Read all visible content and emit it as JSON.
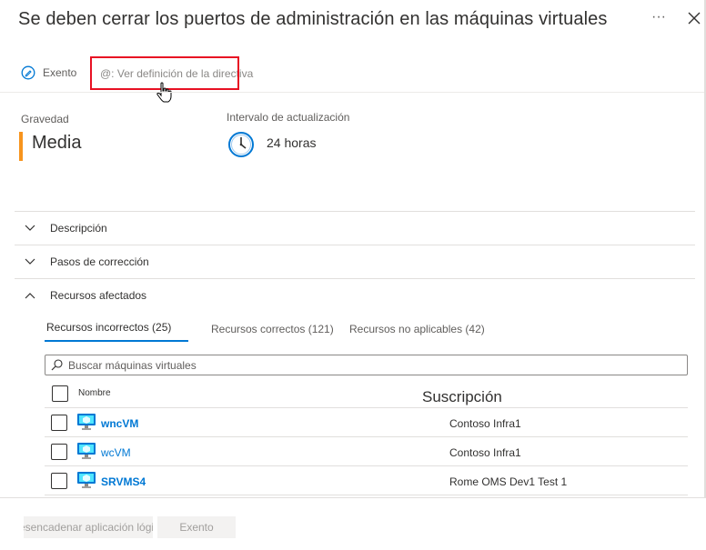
{
  "header": {
    "title": "Se deben cerrar los puertos de administración en las máquinas virtuales",
    "more_label": "···"
  },
  "toolbar": {
    "exempt_label": "Exento",
    "policy_link_label": "@: Ver definición de la directiva"
  },
  "summary": {
    "severity_label": "Gravedad",
    "severity_value": "Media",
    "severity_color": "#f7941d",
    "freshness_label": "Intervalo de actualización",
    "freshness_value": "24 horas"
  },
  "sections": {
    "description": "Descripción",
    "remediation": "Pasos de corrección",
    "affected": "Recursos afectados"
  },
  "tabs": [
    {
      "label": "Recursos incorrectos (25)",
      "active": true
    },
    {
      "label": "Recursos correctos (121)",
      "active": false
    },
    {
      "label": "Recursos no aplicables (42)",
      "active": false
    }
  ],
  "search": {
    "placeholder": "Buscar máquinas virtuales"
  },
  "table": {
    "columns": {
      "name": "Nombre",
      "subscription": "Suscripción"
    },
    "rows": [
      {
        "name": "wncVM",
        "subscription": "Contoso Infra1",
        "icon": "virtual-machine-icon"
      },
      {
        "name": "wcVM",
        "subscription": "Contoso Infra1",
        "icon": "virtual-machine-icon"
      },
      {
        "name": "SRVMS4",
        "subscription": "Rome OMS Dev1 Test 1",
        "icon": "virtual-machine-icon"
      }
    ]
  },
  "footer": {
    "trigger_label": "Desencadenar aplicación lógica",
    "exempt_label": "Exento"
  },
  "colors": {
    "accent": "#0078d4",
    "highlight_box": "#e81123"
  }
}
